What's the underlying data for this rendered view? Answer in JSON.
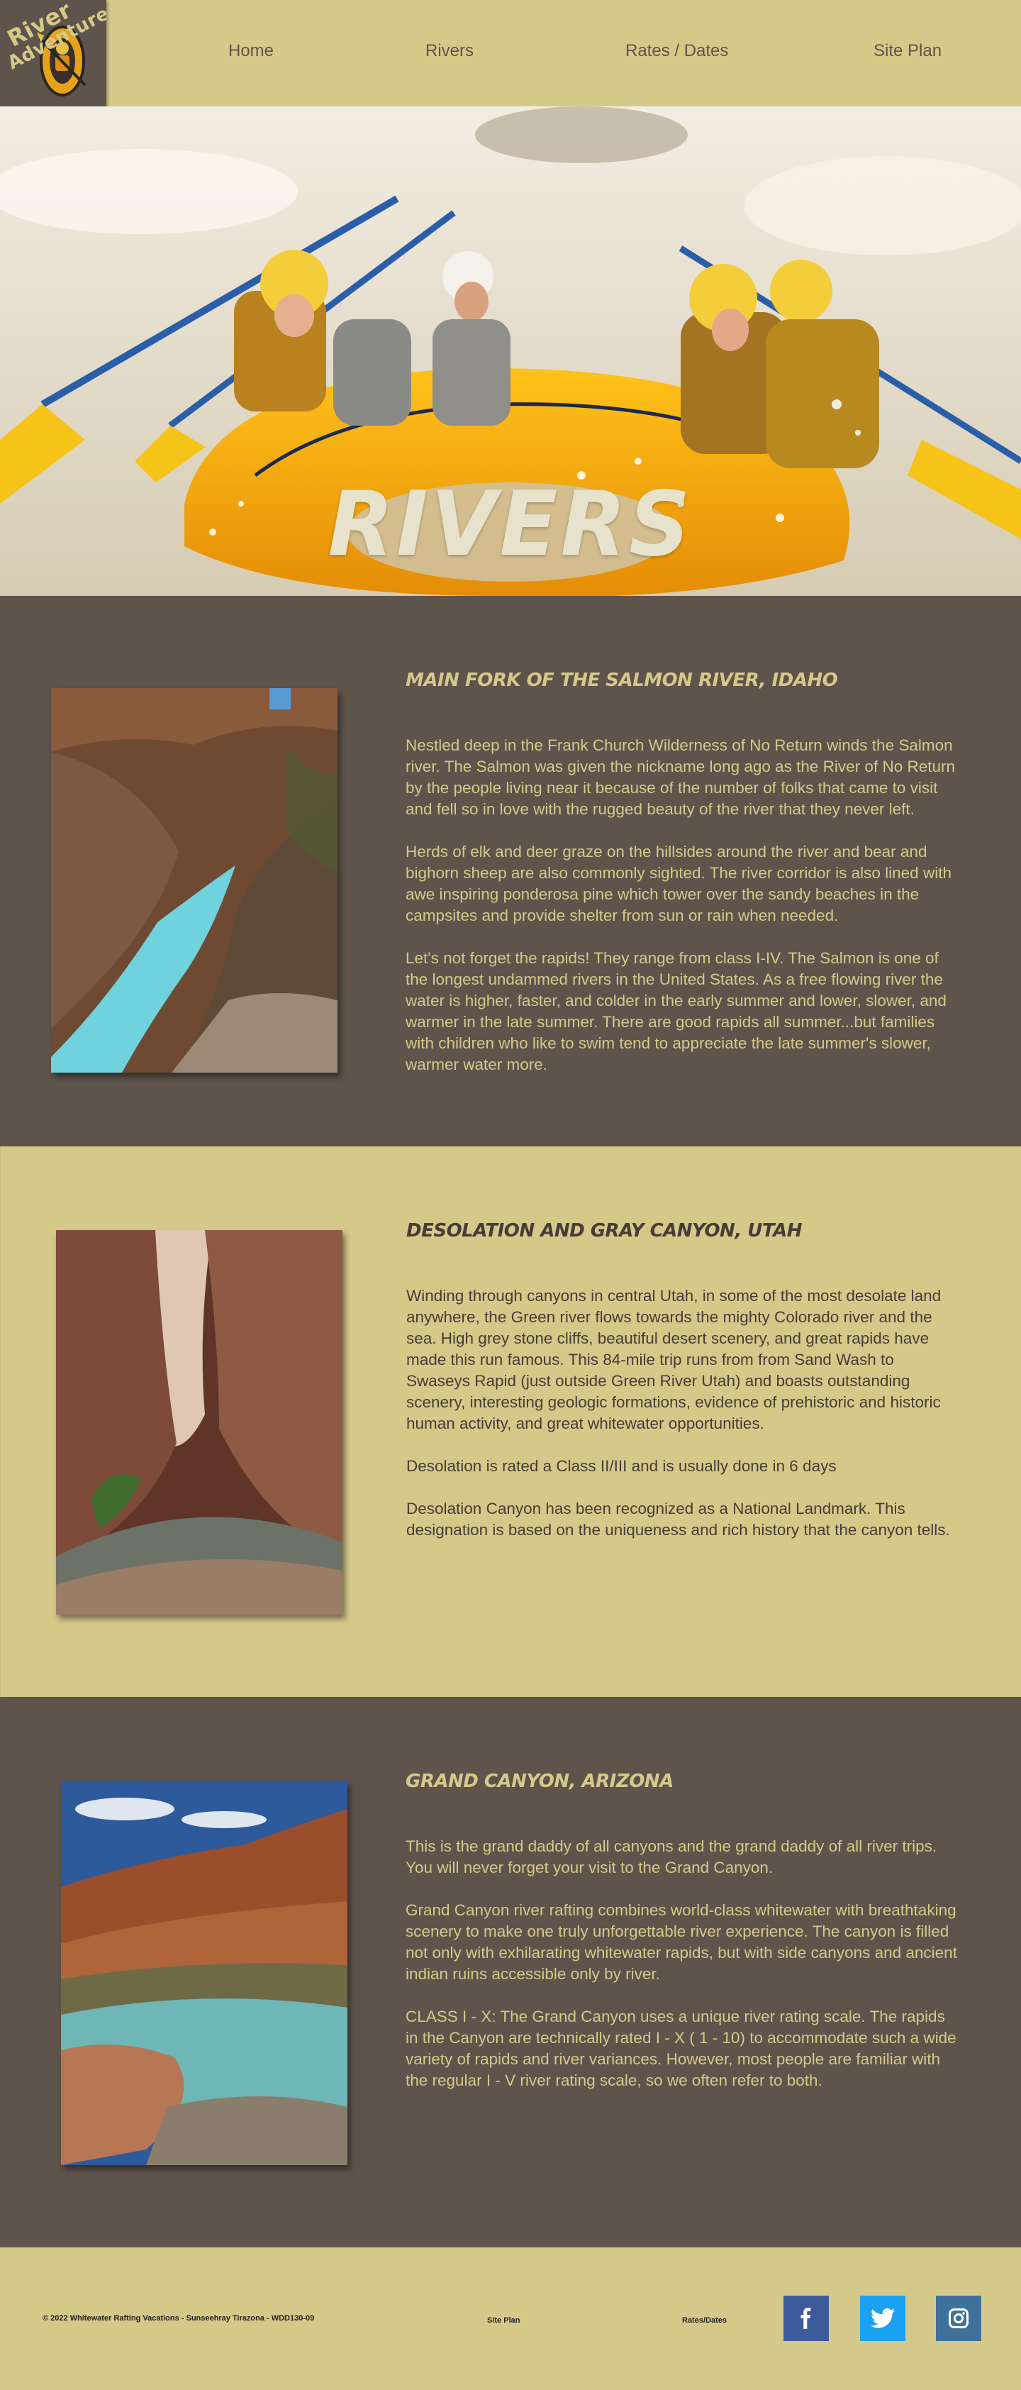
{
  "header": {
    "logo": {
      "text_line1": "River",
      "text_line2": "Adventures",
      "icon": "raft-paddler-logo"
    },
    "nav": [
      {
        "label": "Home"
      },
      {
        "label": "Rivers"
      },
      {
        "label": "Rates / Dates"
      },
      {
        "label": "Site Plan"
      }
    ]
  },
  "hero": {
    "title": "RIVERS",
    "image": "whitewater-rafting-photo"
  },
  "rivers": [
    {
      "title": "Main Fork of the Salmon River, Idaho",
      "image": "turquoise-river-canyon-photo",
      "paragraphs": [
        "Nestled deep in the Frank Church Wilderness of No Return winds the Salmon river. The Salmon was given the nickname long ago as the River of No Return by the people living near it because of the number of folks that came to visit and fell so in love with the rugged beauty of the river that they never left.",
        "Herds of elk and deer graze on the hillsides around the river and bear and bighorn sheep are also commonly sighted. The river corridor is also lined with awe inspiring ponderosa pine which tower over the sandy beaches in the campsites and provide shelter from sun or rain when needed.",
        "Let's not forget the rapids! They range from class I-IV. The Salmon is one of the longest undammed rivers in the United States. As a free flowing river the water is higher, faster, and colder in the early summer and lower, slower, and warmer in the late summer. There are good rapids all summer...but families with children who like to swim tend to appreciate the late summer's slower, warmer water more."
      ]
    },
    {
      "title": "Desolation and Gray Canyon, Utah",
      "image": "slot-canyon-photo",
      "paragraphs": [
        " Winding through canyons in central Utah, in some of the most desolate land anywhere, the Green river flows towards the mighty Colorado river and the sea. High grey stone cliffs, beautiful desert scenery, and great rapids have made this run famous. This 84-mile trip runs from from Sand Wash to Swaseys Rapid (just outside Green River Utah) and boasts outstanding scenery, interesting geologic formations, evidence of prehistoric and historic human activity, and great whitewater opportunities.",
        "Desolation is rated a Class II/III and is usually done in 6 days",
        "Desolation Canyon has been recognized as a National Landmark.  This designation is based on the uniqueness and rich history that the canyon tells."
      ]
    },
    {
      "title": "Grand Canyon, Arizona",
      "image": "grand-canyon-river-photo",
      "paragraphs": [
        " This is the grand daddy of all canyons and the grand daddy of all river trips. You will never forget your visit to the Grand Canyon.",
        "Grand Canyon river rafting combines world-class whitewater with breathtaking scenery to make one truly unforgettable river experience. The canyon is filled not only with exhilarating whitewater rapids, but with side canyons and ancient indian ruins accessible only by river.",
        "CLASS I - X: The Grand Canyon uses a unique river rating scale. The rapids in the Canyon are technically rated I - X ( 1 - 10) to accommodate such a wide variety of rapids and river variances. However, most people are familiar with the regular I - V river rating scale, so we often refer to both."
      ]
    }
  ],
  "footer": {
    "copyright": "© 2022 Whitewater Rafting Vacations - Sunseehray Tirazona - WDD130-09",
    "links": [
      {
        "label": "Site Plan"
      },
      {
        "label": "Rates/Dates"
      }
    ],
    "social": [
      {
        "icon": "facebook-icon",
        "color": "#3d5b9a"
      },
      {
        "icon": "twitter-icon",
        "color": "#1da1f2"
      },
      {
        "icon": "instagram-icon",
        "color": "#3f729b"
      }
    ]
  },
  "colors": {
    "tan": "#d5c98a",
    "brown": "#5e544b",
    "dark_text": "#453d36"
  }
}
